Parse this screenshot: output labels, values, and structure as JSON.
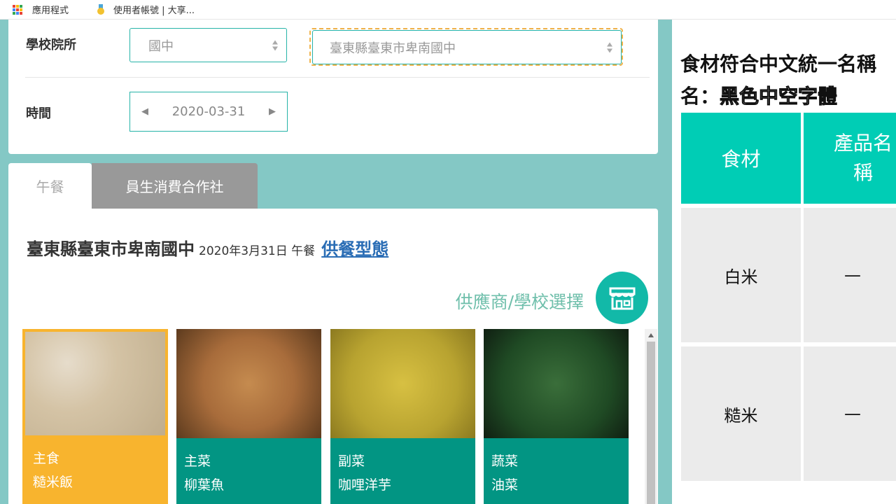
{
  "bookmarks": {
    "apps_label": "應用程式",
    "account_label": "使用者帳號 | 大享..."
  },
  "filters": {
    "school_label": "學校院所",
    "level_value": "國中",
    "school_value": "臺東縣臺東市卑南國中",
    "time_label": "時間",
    "date_value": "2020-03-31",
    "date_prev": "◀",
    "date_next": "▶"
  },
  "tabs": [
    {
      "label": "午餐",
      "active": true
    },
    {
      "label": "員生消費合作社",
      "active": false
    }
  ],
  "menu": {
    "school_name": "臺東縣臺東市卑南國中",
    "date_meal": "2020年3月31日 午餐",
    "supply_link": "供餐型態",
    "supplier_select": "供應商/學校選擇",
    "dishes": [
      {
        "category": "主食",
        "name": "糙米飯",
        "accent": "#f8b42e"
      },
      {
        "category": "主菜",
        "name": "柳葉魚",
        "accent": "#029583"
      },
      {
        "category": "副菜",
        "name": "咖哩洋芋",
        "accent": "#029583"
      },
      {
        "category": "蔬菜",
        "name": "油菜",
        "accent": "#029583"
      }
    ]
  },
  "ingredients": {
    "title": "食材符合中文統一名稱",
    "subtitle_prefix": "名：",
    "subtitle_outline": "黑色中空字體",
    "headers": [
      "食材",
      "產品名稱"
    ],
    "rows": [
      {
        "ingredient": "白米",
        "product": "—"
      },
      {
        "ingredient": "糙米",
        "product": "—"
      }
    ]
  },
  "colors": {
    "teal_bg": "#84c8c5",
    "teal_accent": "#12b9a8",
    "header_teal": "#00cdb5",
    "main_food_orange": "#f8b42e",
    "caption_teal": "#029583"
  }
}
